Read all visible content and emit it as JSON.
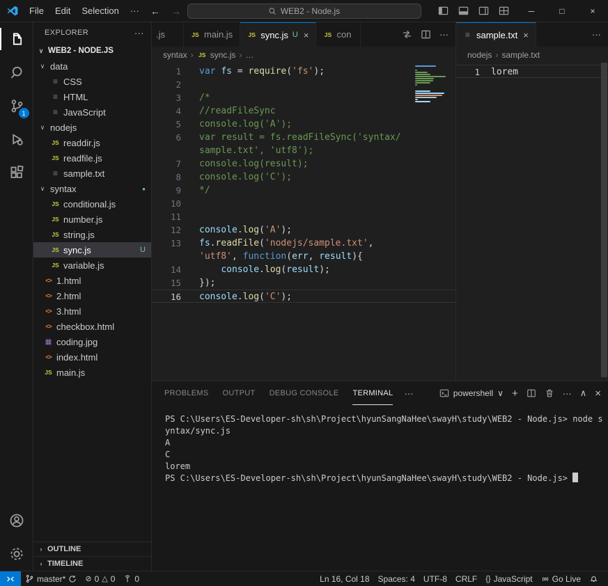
{
  "window": {
    "menus": [
      "File",
      "Edit",
      "Selection"
    ],
    "more_menu": "···",
    "title_search": "WEB2 - Node.js"
  },
  "activity_bar": {
    "scm_badge": "1"
  },
  "explorer": {
    "header": "EXPLORER",
    "root": "WEB2 - NODE.JS",
    "items": [
      {
        "label": "data",
        "type": "folder",
        "level": 1
      },
      {
        "label": "CSS",
        "type": "list",
        "level": 2
      },
      {
        "label": "HTML",
        "type": "list",
        "level": 2
      },
      {
        "label": "JavaScript",
        "type": "list",
        "level": 2
      },
      {
        "label": "nodejs",
        "type": "folder",
        "level": 1
      },
      {
        "label": "readdir.js",
        "type": "js",
        "level": 2
      },
      {
        "label": "readfile.js",
        "type": "js",
        "level": 2
      },
      {
        "label": "sample.txt",
        "type": "list",
        "level": 2
      },
      {
        "label": "syntax",
        "type": "folder",
        "level": 1,
        "dot": true
      },
      {
        "label": "conditional.js",
        "type": "js",
        "level": 2
      },
      {
        "label": "number.js",
        "type": "js",
        "level": 2
      },
      {
        "label": "string.js",
        "type": "js",
        "level": 2
      },
      {
        "label": "sync.js",
        "type": "js",
        "level": 2,
        "selected": true,
        "badge": "U"
      },
      {
        "label": "variable.js",
        "type": "js",
        "level": 2
      },
      {
        "label": "1.html",
        "type": "html",
        "level": 1
      },
      {
        "label": "2.html",
        "type": "html",
        "level": 1
      },
      {
        "label": "3.html",
        "type": "html",
        "level": 1
      },
      {
        "label": "checkbox.html",
        "type": "html",
        "level": 1
      },
      {
        "label": "coding.jpg",
        "type": "img",
        "level": 1
      },
      {
        "label": "index.html",
        "type": "html",
        "level": 1
      },
      {
        "label": "main.js",
        "type": "js",
        "level": 1
      }
    ],
    "sections": [
      "OUTLINE",
      "TIMELINE"
    ]
  },
  "group1": {
    "tabs": [
      {
        "label": ".js",
        "partial": "left"
      },
      {
        "label": "main.js",
        "icon": "js"
      },
      {
        "label": "sync.js",
        "icon": "js",
        "badge": "U",
        "active": true,
        "closable": true
      },
      {
        "label": "con",
        "icon": "js",
        "partial": "right"
      }
    ],
    "breadcrumb": [
      {
        "label": "syntax"
      },
      {
        "label": "sync.js",
        "icon": "js"
      },
      {
        "label": "…"
      }
    ],
    "lines": [
      {
        "num": "1",
        "tokens": [
          [
            "kw",
            "var"
          ],
          [
            "pun",
            " "
          ],
          [
            "var",
            "fs"
          ],
          [
            "pun",
            " = "
          ],
          [
            "fn",
            "require"
          ],
          [
            "pun",
            "("
          ],
          [
            "str",
            "'fs'"
          ],
          [
            "pun",
            ");"
          ]
        ]
      },
      {
        "num": "2",
        "tokens": []
      },
      {
        "num": "3",
        "tokens": [
          [
            "cmt",
            "/*"
          ]
        ]
      },
      {
        "num": "4",
        "tokens": [
          [
            "cmt",
            "//readFileSync"
          ]
        ]
      },
      {
        "num": "5",
        "tokens": [
          [
            "cmt",
            "console.log('A');"
          ]
        ]
      },
      {
        "num": "6",
        "tokens": [
          [
            "cmt",
            "var result = fs.readFileSync('syntax/"
          ]
        ]
      },
      {
        "num": "",
        "tokens": [
          [
            "cmt",
            "sample.txt', 'utf8');"
          ]
        ]
      },
      {
        "num": "7",
        "tokens": [
          [
            "cmt",
            "console.log(result);"
          ]
        ]
      },
      {
        "num": "8",
        "tokens": [
          [
            "cmt",
            "console.log('C');"
          ]
        ]
      },
      {
        "num": "9",
        "tokens": [
          [
            "cmt",
            "*/"
          ]
        ]
      },
      {
        "num": "10",
        "tokens": []
      },
      {
        "num": "11",
        "tokens": []
      },
      {
        "num": "12",
        "tokens": [
          [
            "var",
            "console"
          ],
          [
            "pun",
            "."
          ],
          [
            "fn",
            "log"
          ],
          [
            "pun",
            "("
          ],
          [
            "str",
            "'A'"
          ],
          [
            "pun",
            ");"
          ]
        ]
      },
      {
        "num": "13",
        "tokens": [
          [
            "var",
            "fs"
          ],
          [
            "pun",
            "."
          ],
          [
            "fn",
            "readFile"
          ],
          [
            "pun",
            "("
          ],
          [
            "str",
            "'nodejs/sample.txt'"
          ],
          [
            "pun",
            ","
          ]
        ]
      },
      {
        "num": "",
        "tokens": [
          [
            "str",
            "'utf8'"
          ],
          [
            "pun",
            ", "
          ],
          [
            "kw",
            "function"
          ],
          [
            "pun",
            "("
          ],
          [
            "var",
            "err"
          ],
          [
            "pun",
            ", "
          ],
          [
            "var",
            "result"
          ],
          [
            "pun",
            "){"
          ]
        ]
      },
      {
        "num": "14",
        "tokens": [
          [
            "pun",
            "    "
          ],
          [
            "var",
            "console"
          ],
          [
            "pun",
            "."
          ],
          [
            "fn",
            "log"
          ],
          [
            "pun",
            "("
          ],
          [
            "var",
            "result"
          ],
          [
            "pun",
            ");"
          ]
        ]
      },
      {
        "num": "15",
        "tokens": [
          [
            "pun",
            "});"
          ]
        ]
      },
      {
        "num": "16",
        "active": true,
        "tokens": [
          [
            "var",
            "console"
          ],
          [
            "pun",
            "."
          ],
          [
            "fn",
            "log"
          ],
          [
            "pun",
            "("
          ],
          [
            "str",
            "'C'"
          ],
          [
            "pun",
            ");"
          ]
        ]
      }
    ]
  },
  "group2": {
    "tabs": [
      {
        "label": "sample.txt",
        "icon": "list",
        "active": true,
        "closable": true
      }
    ],
    "breadcrumb": [
      {
        "label": "nodejs"
      },
      {
        "label": "sample.txt"
      }
    ],
    "lines": [
      {
        "num": "1",
        "active": true,
        "tokens": [
          [
            "pun",
            "lorem"
          ]
        ]
      }
    ]
  },
  "panel": {
    "tabs": [
      "PROBLEMS",
      "OUTPUT",
      "DEBUG CONSOLE",
      "TERMINAL"
    ],
    "active_tab": "TERMINAL",
    "shell_label": "powershell",
    "terminal_lines": [
      "PS C:\\Users\\ES-Developer-sh\\sh\\Project\\hyunSangNaHee\\swayH\\study\\WEB2 - Node.js> node s",
      "yntax/sync.js",
      "A",
      "C",
      "lorem",
      "PS C:\\Users\\ES-Developer-sh\\sh\\Project\\hyunSangNaHee\\swayH\\study\\WEB2 - Node.js> "
    ]
  },
  "statusbar": {
    "branch": "master*",
    "errors": "0",
    "warnings": "0",
    "ports": "0",
    "line_col": "Ln 16, Col 18",
    "spaces": "Spaces: 4",
    "encoding": "UTF-8",
    "eol": "CRLF",
    "braces": "{}",
    "language": "JavaScript",
    "live": "Go Live"
  },
  "colors": {
    "accent": "#0078d4",
    "git_untracked": "#73c991",
    "editor_bg": "#1f1f1f",
    "chrome_bg": "#181818"
  },
  "icons": {
    "folder_expanded": "∨",
    "section_collapsed": "›",
    "js": "JS",
    "html": "<>",
    "file": "≡",
    "image": "▦",
    "close": "×",
    "back": "←",
    "forward": "→",
    "more": "···",
    "error": "⊘",
    "warning": "△",
    "plus": "+",
    "chevron_down": "∨",
    "chevron_up": "∧",
    "crumb_sep": "›",
    "dot": "●",
    "minimize": "─",
    "maximize": "□"
  }
}
